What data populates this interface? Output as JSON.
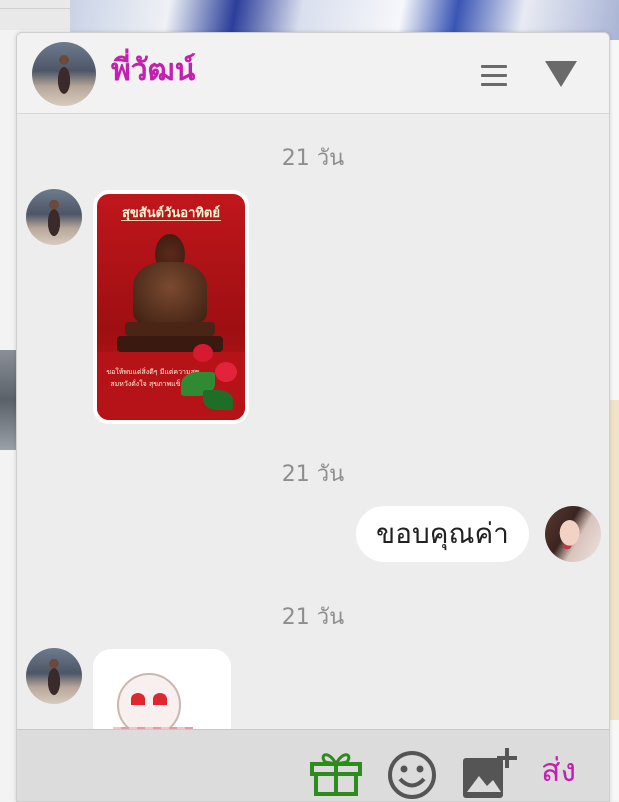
{
  "header": {
    "contact_name": "พี่วัฒน์",
    "menu_icon": "hamburger-menu-icon",
    "collapse_icon": "triangle-down-icon"
  },
  "messages": [
    {
      "type": "date",
      "text": "21 วัน"
    },
    {
      "type": "image",
      "from": "contact",
      "image_title": "สุขสันต์วันอาทิตย์",
      "image_caption": "ขอให้พบแต่สิ่งดีๆ มีแต่ความสุข สมหวังดั่งใจ สุขภาพแข็งแรง"
    },
    {
      "type": "date",
      "text": "21 วัน"
    },
    {
      "type": "text",
      "from": "me",
      "text": "ขอบคุณค่า"
    },
    {
      "type": "date",
      "text": "21 วัน"
    },
    {
      "type": "sticker",
      "from": "contact"
    }
  ],
  "footer": {
    "gift_icon": "gift-icon",
    "emoji_icon": "emoji-icon",
    "photo_icon": "add-photo-icon",
    "send_label": "ส่ง"
  },
  "colors": {
    "accent": "#c41fae",
    "gift_green": "#2e8b1e",
    "icon_gray": "#555555"
  }
}
